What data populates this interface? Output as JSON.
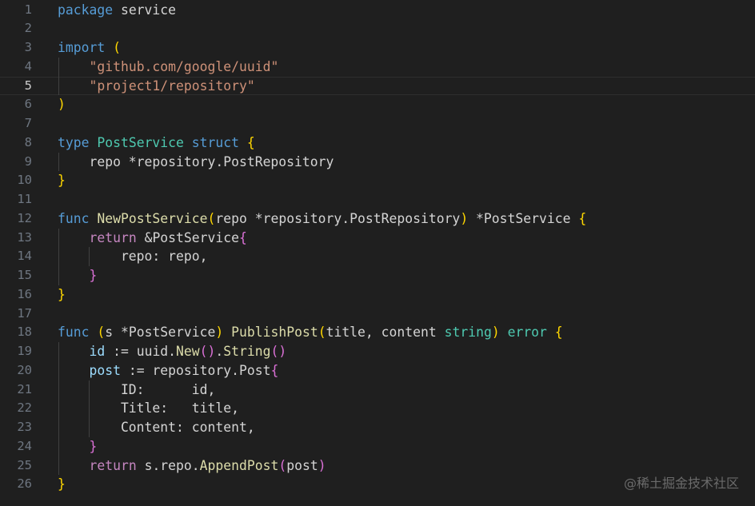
{
  "colors": {
    "background": "#1f1f1f",
    "keyword": "#569cd6",
    "control": "#c586c0",
    "type": "#4ec9b0",
    "function": "#dcdcaa",
    "string": "#ce9178",
    "variable": "#9cdcfe",
    "text": "#d4d4d4",
    "bracket1": "#ffd700",
    "bracket2": "#da70d6",
    "lineNumber": "#6e7681",
    "lineNumberActive": "#cccccc"
  },
  "active_line": 5,
  "watermark": "@稀土掘金技术社区",
  "lines": [
    {
      "number": "1",
      "tokens": [
        {
          "t": "package",
          "c": "keyword"
        },
        {
          "t": " service",
          "c": "text"
        }
      ]
    },
    {
      "number": "2",
      "tokens": []
    },
    {
      "number": "3",
      "tokens": [
        {
          "t": "import",
          "c": "keyword"
        },
        {
          "t": " ",
          "c": "text"
        },
        {
          "t": "(",
          "c": "bracket1"
        }
      ]
    },
    {
      "number": "4",
      "tokens": [
        {
          "t": "    ",
          "c": "text"
        },
        {
          "t": "\"github.com/google/uuid\"",
          "c": "string"
        }
      ]
    },
    {
      "number": "5",
      "tokens": [
        {
          "t": "    ",
          "c": "text"
        },
        {
          "t": "\"project1/repository\"",
          "c": "string"
        }
      ]
    },
    {
      "number": "6",
      "tokens": [
        {
          "t": ")",
          "c": "bracket1"
        }
      ]
    },
    {
      "number": "7",
      "tokens": []
    },
    {
      "number": "8",
      "tokens": [
        {
          "t": "type",
          "c": "keyword"
        },
        {
          "t": " ",
          "c": "text"
        },
        {
          "t": "PostService",
          "c": "type"
        },
        {
          "t": " ",
          "c": "text"
        },
        {
          "t": "struct",
          "c": "keyword"
        },
        {
          "t": " ",
          "c": "text"
        },
        {
          "t": "{",
          "c": "bracket1"
        }
      ]
    },
    {
      "number": "9",
      "tokens": [
        {
          "t": "    repo *repository.PostRepository",
          "c": "text"
        }
      ]
    },
    {
      "number": "10",
      "tokens": [
        {
          "t": "}",
          "c": "bracket1"
        }
      ]
    },
    {
      "number": "11",
      "tokens": []
    },
    {
      "number": "12",
      "tokens": [
        {
          "t": "func",
          "c": "keyword"
        },
        {
          "t": " ",
          "c": "text"
        },
        {
          "t": "NewPostService",
          "c": "function"
        },
        {
          "t": "(",
          "c": "bracket1"
        },
        {
          "t": "repo *repository.PostRepository",
          "c": "text"
        },
        {
          "t": ")",
          "c": "bracket1"
        },
        {
          "t": " *PostService ",
          "c": "text"
        },
        {
          "t": "{",
          "c": "bracket1"
        }
      ]
    },
    {
      "number": "13",
      "tokens": [
        {
          "t": "    ",
          "c": "text"
        },
        {
          "t": "return",
          "c": "control"
        },
        {
          "t": " &PostService",
          "c": "text"
        },
        {
          "t": "{",
          "c": "bracket2"
        }
      ]
    },
    {
      "number": "14",
      "tokens": [
        {
          "t": "        repo: repo,",
          "c": "text"
        }
      ]
    },
    {
      "number": "15",
      "tokens": [
        {
          "t": "    ",
          "c": "text"
        },
        {
          "t": "}",
          "c": "bracket2"
        }
      ]
    },
    {
      "number": "16",
      "tokens": [
        {
          "t": "}",
          "c": "bracket1"
        }
      ]
    },
    {
      "number": "17",
      "tokens": []
    },
    {
      "number": "18",
      "tokens": [
        {
          "t": "func",
          "c": "keyword"
        },
        {
          "t": " ",
          "c": "text"
        },
        {
          "t": "(",
          "c": "bracket1"
        },
        {
          "t": "s *PostService",
          "c": "text"
        },
        {
          "t": ")",
          "c": "bracket1"
        },
        {
          "t": " ",
          "c": "text"
        },
        {
          "t": "PublishPost",
          "c": "function"
        },
        {
          "t": "(",
          "c": "bracket1"
        },
        {
          "t": "title, content ",
          "c": "text"
        },
        {
          "t": "string",
          "c": "type"
        },
        {
          "t": ")",
          "c": "bracket1"
        },
        {
          "t": " ",
          "c": "text"
        },
        {
          "t": "error",
          "c": "type"
        },
        {
          "t": " ",
          "c": "text"
        },
        {
          "t": "{",
          "c": "bracket1"
        }
      ]
    },
    {
      "number": "19",
      "tokens": [
        {
          "t": "    ",
          "c": "text"
        },
        {
          "t": "id",
          "c": "variable"
        },
        {
          "t": " := uuid.",
          "c": "text"
        },
        {
          "t": "New",
          "c": "function"
        },
        {
          "t": "()",
          "c": "bracket2"
        },
        {
          "t": ".",
          "c": "text"
        },
        {
          "t": "String",
          "c": "function"
        },
        {
          "t": "()",
          "c": "bracket2"
        }
      ]
    },
    {
      "number": "20",
      "tokens": [
        {
          "t": "    ",
          "c": "text"
        },
        {
          "t": "post",
          "c": "variable"
        },
        {
          "t": " := repository.Post",
          "c": "text"
        },
        {
          "t": "{",
          "c": "bracket2"
        }
      ]
    },
    {
      "number": "21",
      "tokens": [
        {
          "t": "        ID:      id,",
          "c": "text"
        }
      ]
    },
    {
      "number": "22",
      "tokens": [
        {
          "t": "        Title:   title,",
          "c": "text"
        }
      ]
    },
    {
      "number": "23",
      "tokens": [
        {
          "t": "        Content: content,",
          "c": "text"
        }
      ]
    },
    {
      "number": "24",
      "tokens": [
        {
          "t": "    ",
          "c": "text"
        },
        {
          "t": "}",
          "c": "bracket2"
        }
      ]
    },
    {
      "number": "25",
      "tokens": [
        {
          "t": "    ",
          "c": "text"
        },
        {
          "t": "return",
          "c": "control"
        },
        {
          "t": " s.repo.",
          "c": "text"
        },
        {
          "t": "AppendPost",
          "c": "function"
        },
        {
          "t": "(",
          "c": "bracket2"
        },
        {
          "t": "post",
          "c": "text"
        },
        {
          "t": ")",
          "c": "bracket2"
        }
      ]
    },
    {
      "number": "26",
      "tokens": [
        {
          "t": "}",
          "c": "bracket1"
        }
      ]
    }
  ]
}
